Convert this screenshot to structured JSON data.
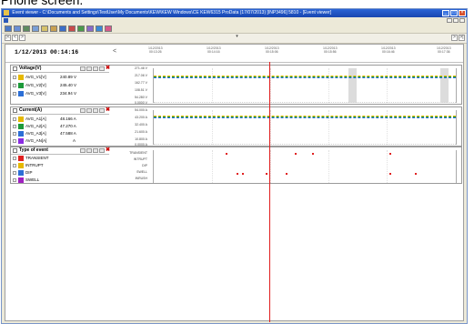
{
  "caption": {
    "text": "Phone screen."
  },
  "window": {
    "title": "Event viewer - C:\\Documents and Settings\\TestUser\\My Documents\\KEW\\KEW Windows\\CE KEW6315 ProData (17/07/2013) [INP3496] 5810 - [Event viewer]",
    "buttons": {
      "minimize": "_",
      "maximize": "□",
      "close": "×"
    }
  },
  "toolbar": {
    "icons": [
      "open-icon",
      "save-icon",
      "print-icon",
      "cut-icon",
      "copy-icon",
      "zoom-in-icon",
      "zoom-out-icon",
      "chart-icon",
      "table-icon",
      "settings-icon",
      "help-icon",
      "export-icon"
    ]
  },
  "nav": {
    "first": "|<",
    "prev": "<",
    "next": ">",
    "last": ">|",
    "down": "▾"
  },
  "timeline": {
    "date": "1/12/2013 00:14:16",
    "ticks": [
      {
        "date": "1/12/2013",
        "time": "00:13:26"
      },
      {
        "date": "1/12/2013",
        "time": "00:14:16"
      },
      {
        "date": "1/12/2013",
        "time": "00:15:06"
      },
      {
        "date": "1/12/2013",
        "time": "00:15:56"
      },
      {
        "date": "1/12/2013",
        "time": "00:16:46"
      },
      {
        "date": "1/12/2013",
        "time": "00:17:36"
      }
    ]
  },
  "voltage": {
    "title": "Voltage(V)",
    "rows": [
      {
        "label": "AVG_V1[V]",
        "value": "240.89",
        "unit": "V",
        "color": "#e6b800"
      },
      {
        "label": "AVG_V2[V]",
        "value": "245.40",
        "unit": "V",
        "color": "#1d9a3a"
      },
      {
        "label": "AVG_V3[V]",
        "value": "234.94",
        "unit": "V",
        "color": "#2c6fd6"
      }
    ],
    "ylabels": [
      "271.46 V",
      "217.06 V",
      "162.77 V",
      "108.51 V",
      "54.280 V",
      "0.0000 V"
    ]
  },
  "current": {
    "title": "Current(A)",
    "rows": [
      {
        "label": "AVG_A1[A]",
        "value": "48.166",
        "unit": "A",
        "color": "#e6b800"
      },
      {
        "label": "AVG_A2[A]",
        "value": "47.270",
        "unit": "A",
        "color": "#1d9a3a"
      },
      {
        "label": "AVG_A3[A]",
        "value": "47.588",
        "unit": "A",
        "color": "#2c6fd6"
      },
      {
        "label": "AVG_AN[A]",
        "value": "",
        "unit": "A",
        "color": "#8a2be2"
      }
    ],
    "ylabels": [
      "54.000 A",
      "43.200 A",
      "32.400 A",
      "21.600 A",
      "10.800 A",
      "0.0000 A"
    ]
  },
  "events": {
    "title": "Type of event",
    "rows": [
      {
        "label": "TRANSIENT",
        "color": "#e02020"
      },
      {
        "label": "INTRUPT",
        "color": "#e6b800"
      },
      {
        "label": "DIP",
        "color": "#2c6fd6"
      },
      {
        "label": "SWELL",
        "color": "#a020c0"
      }
    ],
    "ylabels": [
      "TRANSIENT",
      "INTRUPT",
      "DIP",
      "SWELL",
      "INRUSH"
    ]
  }
}
